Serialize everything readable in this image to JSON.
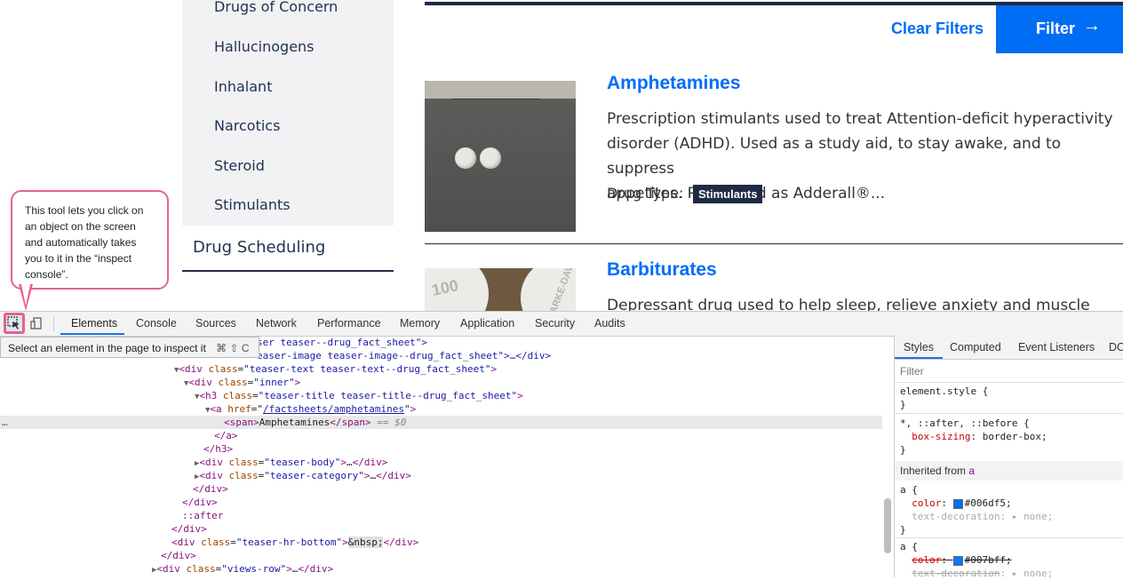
{
  "sidebar": {
    "categories": [
      "Drugs of Concern",
      "Hallucinogens",
      "Inhalant",
      "Narcotics",
      "Steroid",
      "Stimulants"
    ],
    "scheduling_link": "Drug Scheduling"
  },
  "filters": {
    "clear_label": "Clear Filters",
    "filter_label": "Filter",
    "filter_arrow": "→"
  },
  "results": [
    {
      "title": "Amphetamines",
      "lines": [
        "Prescription stimulants used to treat Attention-deficit hyperactivity",
        "disorder (ADHD). Used as a study aid, to stay awake, and to suppress",
        "appetites. Prescribed as Adderall®..."
      ],
      "type_label": "Drug Type:",
      "type_value": "Stimulants"
    },
    {
      "title": "Barbiturates",
      "lines": [
        "Depressant drug used to help sleep, relieve anxiety and muscle spasms,"
      ],
      "thumb_text": "100",
      "thumb_text_2": "PARKE-DAVIS"
    }
  ],
  "callout": {
    "text": "This tool lets you click on an object on the screen and automatically takes you to it in the “inspect console”."
  },
  "devtools": {
    "tabs": [
      "Elements",
      "Console",
      "Sources",
      "Network",
      "Performance",
      "Memory",
      "Application",
      "Security",
      "Audits"
    ],
    "active_tab": "Elements",
    "tooltip": "Select an element in the page to inspect it",
    "tooltip_shortcut": "⌘ ⇧ C",
    "dom": {
      "l0_tail": "ser teaser--drug_fact_sheet\">",
      "l1_tail": "easer-image teaser-image--drug_fact_sheet\">…</div>",
      "div_tag": "div",
      "class_attr": "class",
      "teaser_text": "\"teaser-text teaser-text--drug_fact_sheet\"",
      "inner": "\"inner\"",
      "h3_tag": "h3",
      "teaser_title": "\"teaser-title teaser-title--drug_fact_sheet\"",
      "a_tag": "a",
      "href_attr": "href",
      "href_val": "/factsheets/amphetamines",
      "span_tag": "span",
      "span_text": "Amphetamines",
      "dollar0": "== $0",
      "teaser_body": "\"teaser-body\"",
      "teaser_category": "\"teaser-category\"",
      "after": "::after",
      "hr_bottom": "\"teaser-hr-bottom\"",
      "nbsp": "&nbsp;",
      "views_row": "\"views-row\""
    },
    "styles": {
      "tabs": [
        "Styles",
        "Computed",
        "Event Listeners",
        "DO"
      ],
      "filter_placeholder": "Filter",
      "element_style": "element.style {",
      "close_brace": "}",
      "universal_selector": "*, ::after, ::before {",
      "box_sizing_prop": "box-sizing",
      "box_sizing_val": "border-box;",
      "inherited_label": "Inherited from",
      "inherited_tag": "a",
      "a_selector": "a {",
      "color_prop": "color",
      "color_val_1": "#006df5;",
      "text_decoration_prop": "text-decoration",
      "text_decoration_val": "none;",
      "color_val_2": "#007bff;",
      "swatch_1": "#006df5",
      "swatch_2": "#007bff"
    }
  },
  "colors": {
    "accent": "#006df5",
    "navy": "#1f2a44",
    "callout_border": "#e8628a"
  }
}
